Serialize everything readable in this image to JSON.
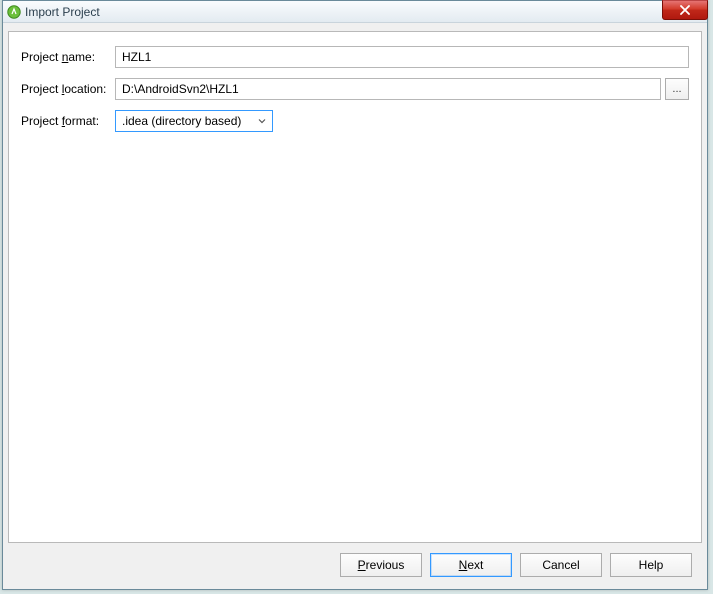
{
  "titlebar": {
    "title": "Import Project"
  },
  "form": {
    "project_name": {
      "label_pre": "Project ",
      "label_u": "n",
      "label_post": "ame:",
      "value": "HZL1"
    },
    "project_location": {
      "label_pre": "Project ",
      "label_u": "l",
      "label_post": "ocation:",
      "value": "D:\\AndroidSvn2\\HZL1",
      "browse": "..."
    },
    "project_format": {
      "label_pre": "Project ",
      "label_u": "f",
      "label_post": "ormat:",
      "value": ".idea (directory based)"
    }
  },
  "buttons": {
    "previous_u": "P",
    "previous_rest": "revious",
    "next_u": "N",
    "next_rest": "ext",
    "cancel": "Cancel",
    "help": "Help"
  }
}
